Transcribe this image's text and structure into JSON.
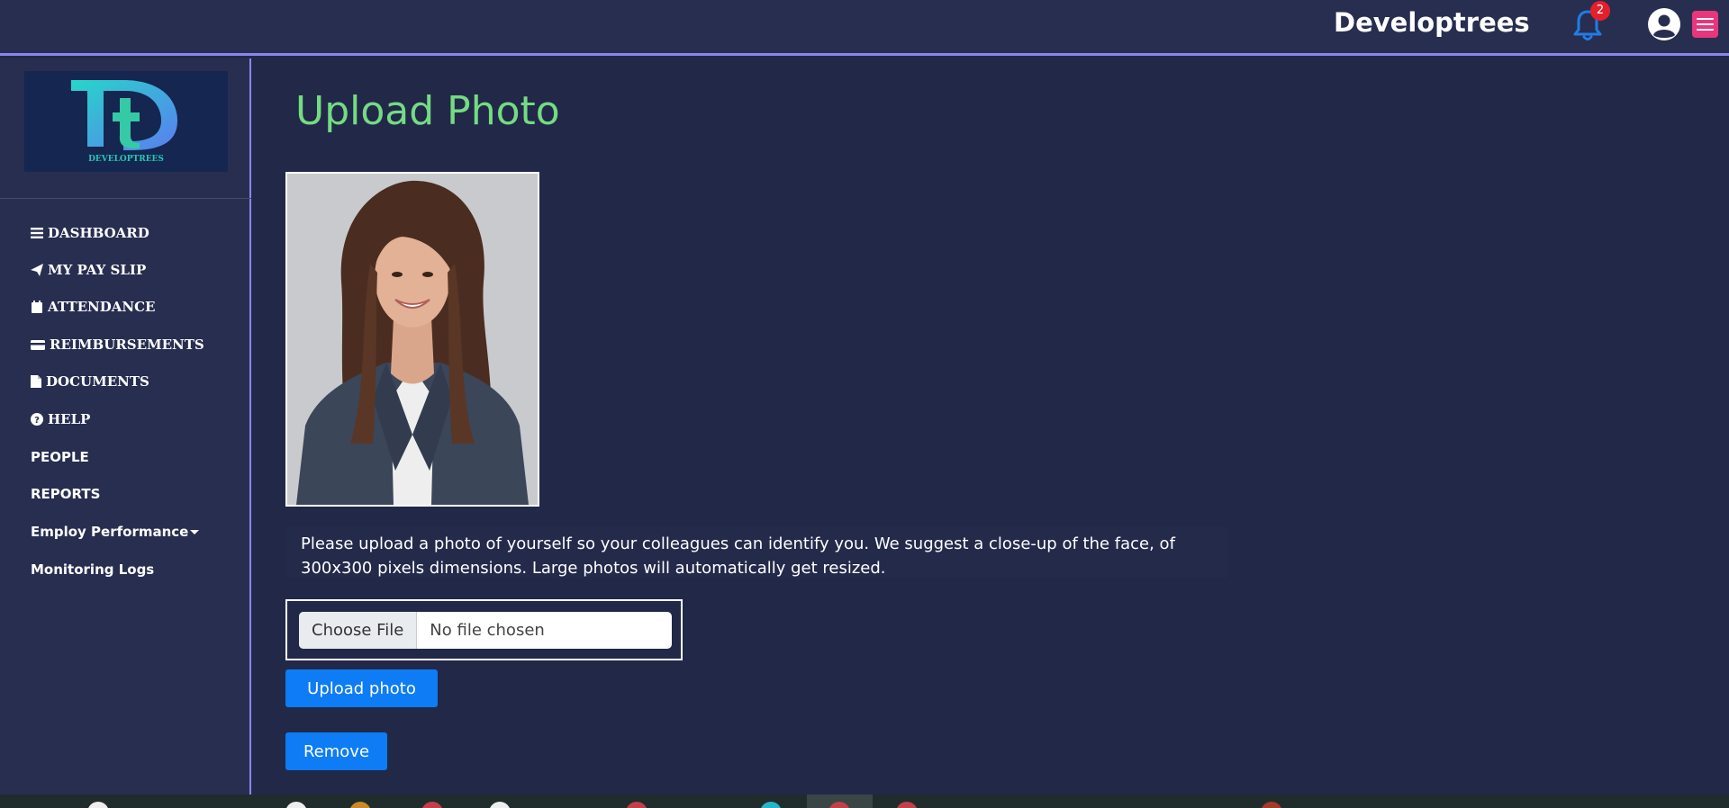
{
  "header": {
    "brand": "Developtrees",
    "notification_count": "2",
    "icons": [
      "bell-icon",
      "user-circle-icon",
      "hamburger-menu-icon"
    ],
    "accent_color": "#e8367c"
  },
  "sidebar": {
    "logo_text": "DEVELOPTREES",
    "items": [
      {
        "label": "DASHBOARD",
        "icon": "bars-icon"
      },
      {
        "label": "MY PAY SLIP",
        "icon": "paper-plane-icon"
      },
      {
        "label": "ATTENDANCE",
        "icon": "calendar-icon"
      },
      {
        "label": "REIMBURSEMENTS",
        "icon": "credit-card-icon"
      },
      {
        "label": "DOCUMENTS",
        "icon": "file-icon"
      },
      {
        "label": "HELP",
        "icon": "question-circle-icon"
      },
      {
        "label": "PEOPLE"
      },
      {
        "label": "REPORTS"
      },
      {
        "label": "Employ Performance",
        "icon": "caret-down-icon"
      },
      {
        "label": "Monitoring Logs"
      }
    ]
  },
  "main": {
    "title": "Upload Photo",
    "title_color": "#74db83",
    "hint": "Please upload a photo of yourself so your colleagues can identify you. We suggest a close-up of the face, of 300x300 pixels dimensions. Large photos will automatically get resized.",
    "file_input": {
      "button_label": "Choose File",
      "status": "No file chosen"
    },
    "upload_button": "Upload photo",
    "remove_button": "Remove",
    "button_color": "#0d7cf5"
  }
}
